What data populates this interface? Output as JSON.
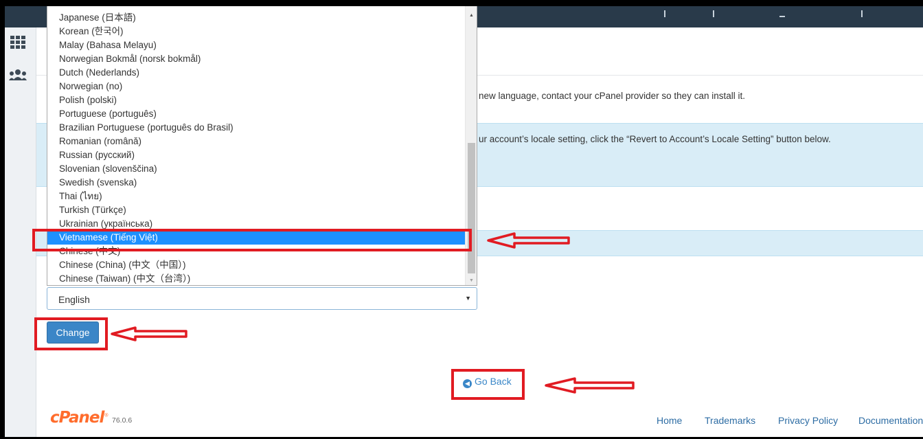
{
  "dropdown": {
    "options": [
      "Japanese (日本語)",
      "Korean (한국어)",
      "Malay (Bahasa Melayu)",
      "Norwegian Bokmål (norsk bokmål)",
      "Dutch (Nederlands)",
      "Norwegian (no)",
      "Polish (polski)",
      "Portuguese (português)",
      "Brazilian Portuguese (português do Brasil)",
      "Romanian (română)",
      "Russian (русский)",
      "Slovenian (slovenščina)",
      "Swedish (svenska)",
      "Thai (ไทย)",
      "Turkish (Türkçe)",
      "Ukrainian (українська)",
      "Vietnamese (Tiếng Việt)",
      "Chinese (中文)",
      "Chinese (China) (中文（中国）)",
      "Chinese (Taiwan) (中文（台湾）)"
    ],
    "highlighted": "Vietnamese (Tiếng Việt)"
  },
  "select": {
    "value": "English"
  },
  "info": {
    "line1": "new language, contact your cPanel provider so they can install it.",
    "line2": "ur account’s locale setting, click the “Revert to Account’s Locale Setting” button below."
  },
  "buttons": {
    "change": "Change",
    "go_back": "Go Back"
  },
  "footer": {
    "logo": "cPanel",
    "version": "76.0.6",
    "links": [
      "Home",
      "Trademarks",
      "Privacy Policy",
      "Documentation"
    ]
  },
  "colors": {
    "highlight": "#1e90ff",
    "button": "#3b86c7",
    "annotation": "#e11b22",
    "brand": "#ff6c2c",
    "info_bg": "#d9edf7"
  },
  "icons": [
    "grid-icon",
    "users-icon",
    "arrow-circle-left-icon",
    "caret-down-icon"
  ]
}
